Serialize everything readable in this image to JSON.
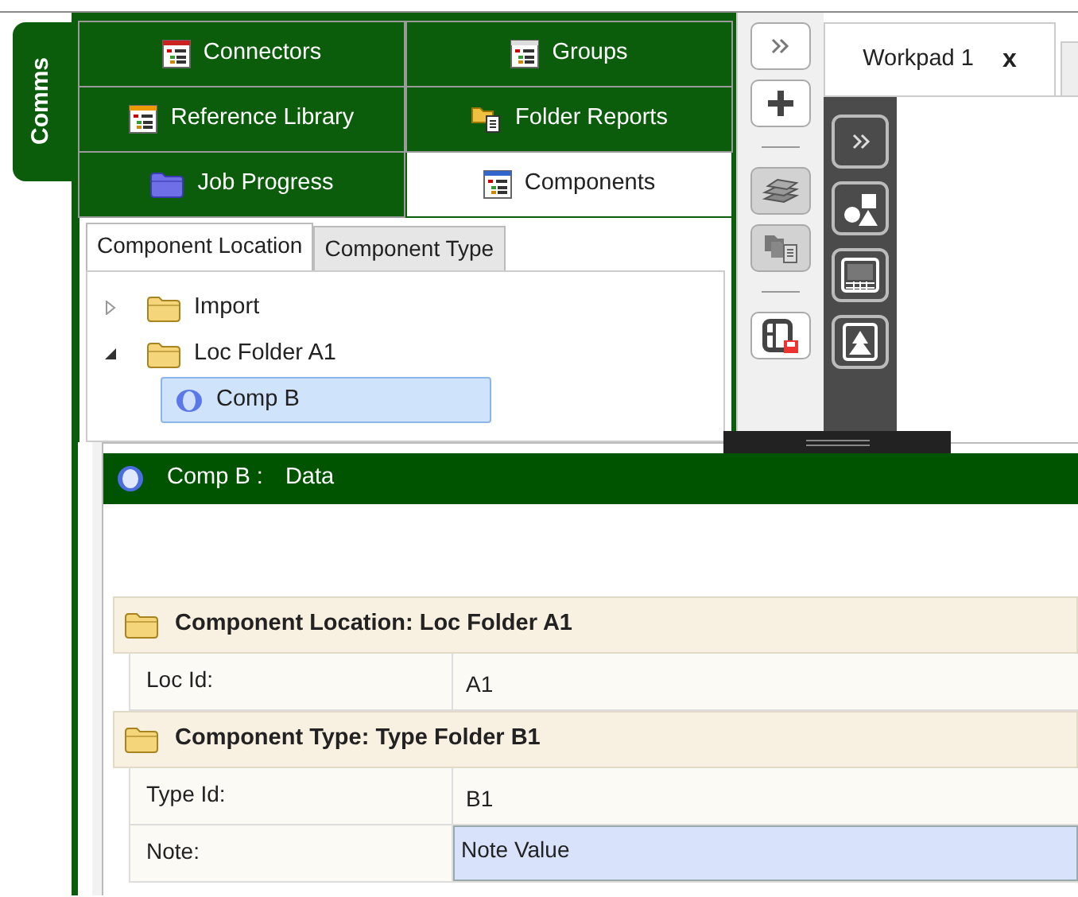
{
  "side_tab": {
    "label": "Comms",
    "selected": true
  },
  "tab_rows": [
    [
      {
        "label": "Connectors",
        "kind": "list-red",
        "selected": false
      },
      {
        "label": "Groups",
        "kind": "list",
        "selected": false
      }
    ],
    [
      {
        "label": "Reference Library",
        "kind": "list-orange",
        "selected": false
      },
      {
        "label": "Folder Reports",
        "kind": "folder-report",
        "selected": false
      }
    ],
    [
      {
        "label": "Job Progress",
        "kind": "folder",
        "selected": false
      },
      {
        "label": "Components",
        "kind": "list-blue",
        "selected": true
      }
    ]
  ],
  "sub_tabs": [
    {
      "label": "Component Location",
      "selected": true
    },
    {
      "label": "Component Type",
      "selected": false
    }
  ],
  "tree": [
    {
      "label": "Import",
      "kind": "folder",
      "expanded": false,
      "selected": false
    },
    {
      "label": "Loc Folder A1",
      "kind": "folder",
      "expanded": true,
      "selected": false,
      "children": [
        {
          "label": "Comp B",
          "kind": "component",
          "selected": true
        }
      ]
    }
  ],
  "toolbar": [
    {
      "kind": "expand",
      "disabled": false
    },
    {
      "kind": "add",
      "disabled": false
    },
    {
      "kind": "separator"
    },
    {
      "kind": "books",
      "disabled": true
    },
    {
      "kind": "folders",
      "disabled": true
    },
    {
      "kind": "separator"
    },
    {
      "kind": "save",
      "disabled": false
    }
  ],
  "workpad_tabs": [
    {
      "label": "Workpad 1",
      "close": "x",
      "selected": true
    }
  ],
  "palette": [
    {
      "kind": "expand"
    },
    {
      "kind": "shapes"
    },
    {
      "kind": "screen"
    },
    {
      "kind": "tree"
    }
  ],
  "data_panel": {
    "title": "Comp B :",
    "subtitle": "Data",
    "categories": [
      {
        "title": "Component Location: Loc Folder A1",
        "rows": [
          {
            "label": "Loc Id:",
            "value": "A1",
            "selected": false
          }
        ]
      },
      {
        "title": "Component Type: Type Folder B1",
        "rows": [
          {
            "label": "Type Id:",
            "value": "B1",
            "selected": false
          },
          {
            "label": "Note:",
            "value": "Note Value",
            "selected": true
          }
        ]
      }
    ]
  }
}
